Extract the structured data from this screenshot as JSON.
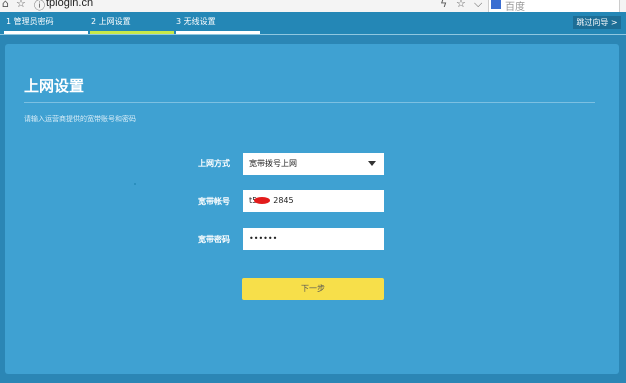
{
  "browser": {
    "url": "tplogin.cn",
    "search_placeholder": "百度"
  },
  "steps": [
    {
      "label": "1 管理员密码",
      "bar_color": "#ffffff"
    },
    {
      "label": "2 上网设置",
      "bar_color": "#c8e84a"
    },
    {
      "label": "3 无线设置",
      "bar_color": "#ffffff"
    }
  ],
  "skip_label": "跳过向导 >",
  "page": {
    "title": "上网设置",
    "subtitle": "请输入运营商提供的宽带账号和密码"
  },
  "form": {
    "connection_label": "上网方式",
    "connection_value": "宽带拨号上网",
    "account_label": "宽带帐号",
    "account_value_prefix": "t5",
    "account_value_suffix": "2845",
    "password_label": "宽带密码",
    "password_value": "••••••",
    "next_label": "下一步"
  },
  "colors": {
    "header": "#2487b6",
    "panel": "#3fa1d2",
    "button": "#f7df4a",
    "active_step": "#c8e84a"
  }
}
